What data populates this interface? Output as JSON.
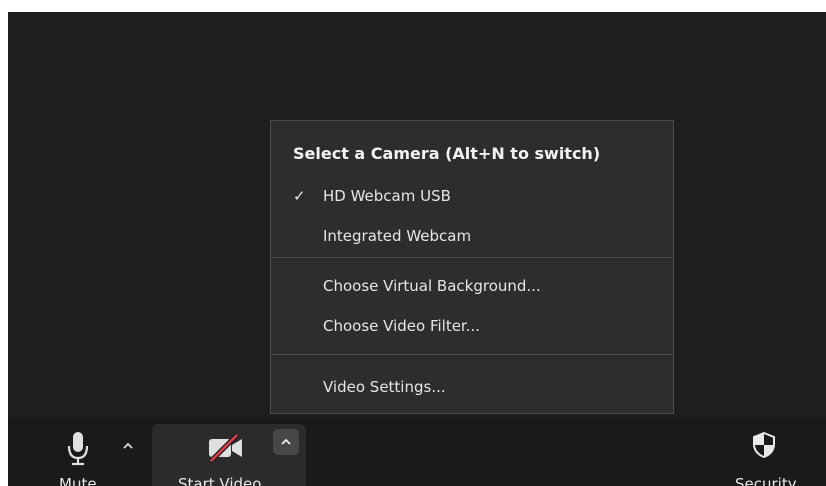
{
  "camera_menu": {
    "header": "Select a Camera (Alt+N to switch)",
    "cameras": [
      {
        "label": "HD Webcam USB",
        "selected": true,
        "check": "✓"
      },
      {
        "label": "Integrated Webcam",
        "selected": false,
        "check": ""
      }
    ],
    "options": [
      {
        "label": "Choose Virtual Background..."
      },
      {
        "label": "Choose Video Filter..."
      }
    ],
    "settings": {
      "label": "Video Settings..."
    }
  },
  "toolbar": {
    "mute": {
      "label": "Mute",
      "icon": "microphone-icon"
    },
    "start_video": {
      "label": "Start Video",
      "icon": "video-off-icon",
      "muted_slash_color": "#e0404a"
    },
    "security": {
      "label": "Security",
      "icon": "shield-icon"
    }
  }
}
